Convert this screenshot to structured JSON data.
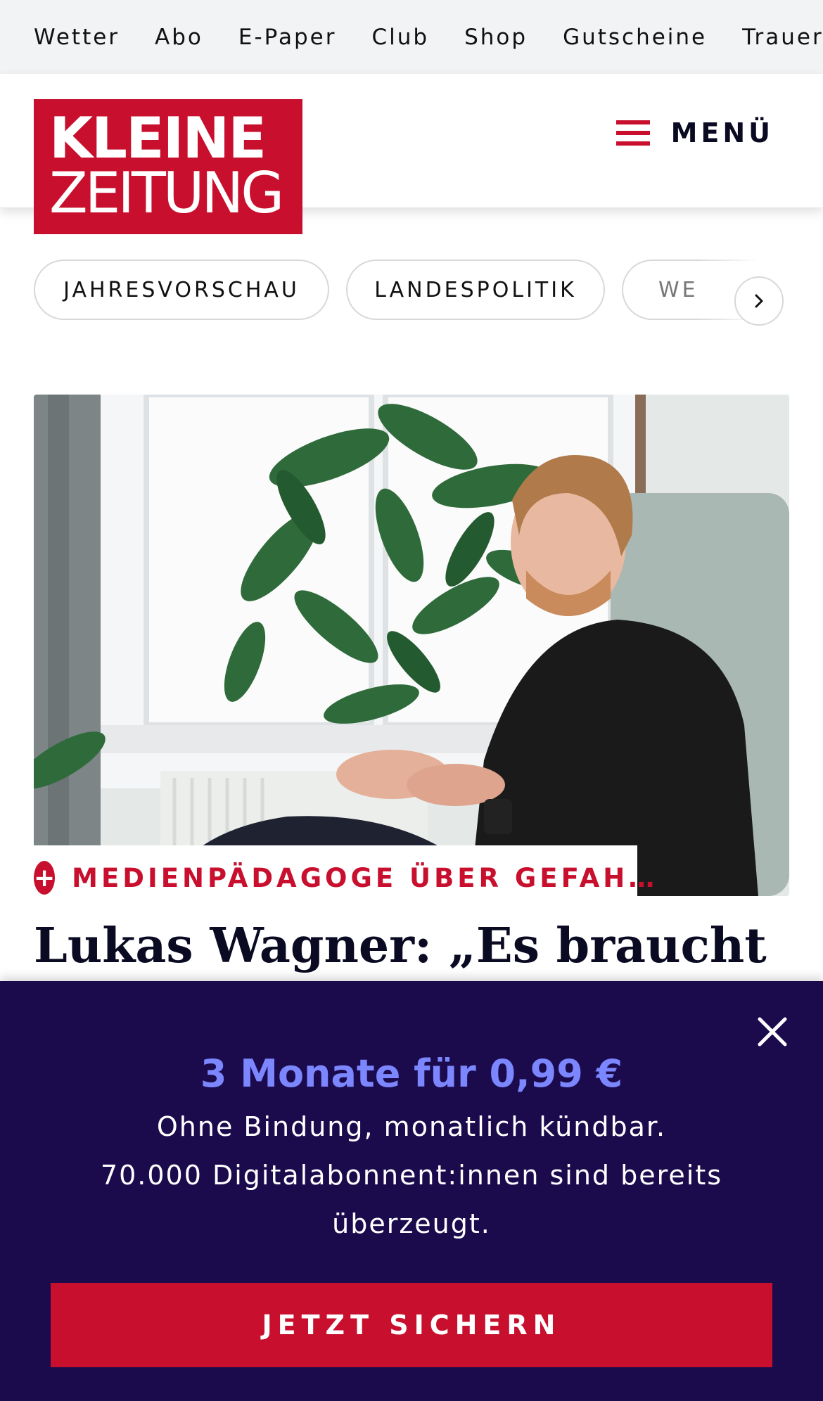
{
  "topnav": {
    "items": [
      "Wetter",
      "Abo",
      "E-Paper",
      "Club",
      "Shop",
      "Gutscheine",
      "Trauerp"
    ]
  },
  "header": {
    "logo_line1": "KLEINE",
    "logo_line2": "ZEITUNG",
    "menu_label": "MENÜ"
  },
  "categories": {
    "items": [
      "JAHRESVORSCHAU",
      "LANDESPOLITIK",
      "WE"
    ]
  },
  "article": {
    "kicker": "MEDIENPÄDAGOGE ÜBER GEFAH…",
    "headline": "Lukas Wagner: „Es braucht"
  },
  "promo": {
    "title": "3 Monate für 0,99 €",
    "line1": "Ohne Bindung, monatlich kündbar.",
    "line2": "70.000 Digitalabonnent:innen sind bereits",
    "line3": "überzeugt.",
    "cta_label": "JETZT SICHERN"
  },
  "colors": {
    "brand_red": "#c8102e",
    "promo_bg": "#1b0b4d",
    "promo_accent": "#7b86ff"
  }
}
